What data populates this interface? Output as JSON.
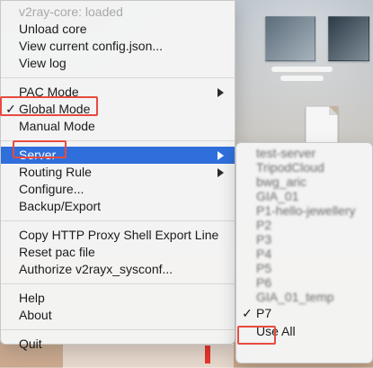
{
  "menu": {
    "status": "v2ray-core: loaded",
    "core_items": [
      "Unload core",
      "View current config.json...",
      "View log"
    ],
    "mode_items": [
      {
        "label": "PAC Mode",
        "checked": false,
        "submenu": true
      },
      {
        "label": "Global Mode",
        "checked": true,
        "submenu": false
      },
      {
        "label": "Manual Mode",
        "checked": false,
        "submenu": false
      }
    ],
    "server": {
      "label": "Server",
      "submenu": true
    },
    "config_items": [
      {
        "label": "Routing Rule",
        "submenu": true
      },
      {
        "label": "Configure...",
        "submenu": false
      },
      {
        "label": "Backup/Export",
        "submenu": false
      }
    ],
    "proxy_items": [
      "Copy HTTP Proxy Shell Export Line",
      "Reset pac file",
      "Authorize v2rayx_sysconf..."
    ],
    "help_items": [
      "Help",
      "About"
    ],
    "quit": "Quit",
    "checkmark": "✓"
  },
  "submenu": {
    "blurred_servers": [
      "test-server",
      "TripodCloud",
      "bwg_aric",
      "GIA_01",
      "P1-hello-jewellery",
      "P2",
      "P3",
      "P4",
      "P5",
      "P6",
      "GIA_01_temp"
    ],
    "selected": "P7",
    "use_all": "Use All"
  },
  "colors": {
    "highlight": "#2f6fdc",
    "annotation_red": "#e84a3f"
  }
}
